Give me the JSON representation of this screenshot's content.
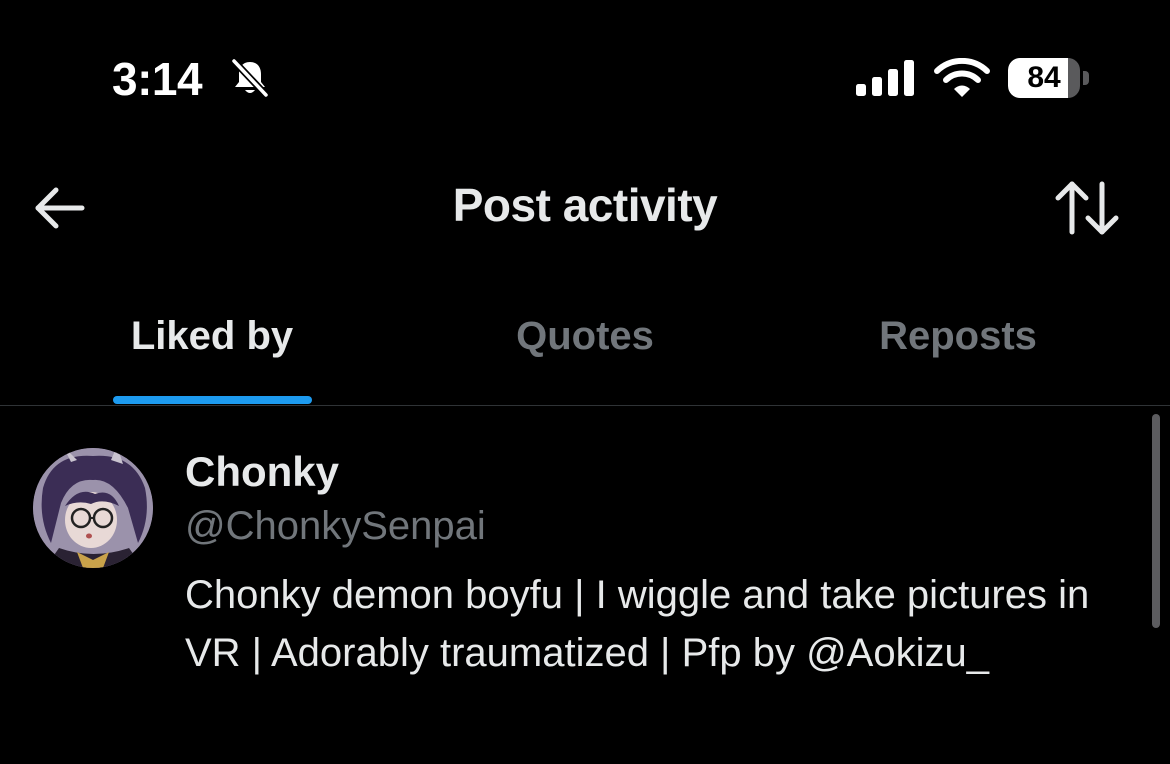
{
  "status_bar": {
    "time": "3:14",
    "silent_icon": "bell-slash-icon",
    "signal_icon": "cellular-signal-icon",
    "wifi_icon": "wifi-icon",
    "battery_percent": "84",
    "battery_level": 0.84
  },
  "header": {
    "back_icon": "arrow-left-icon",
    "title": "Post activity",
    "sort_icon": "sort-arrows-icon"
  },
  "tabs": [
    {
      "label": "Liked by",
      "active": true
    },
    {
      "label": "Quotes",
      "active": false
    },
    {
      "label": "Reposts",
      "active": false
    }
  ],
  "colors": {
    "accent": "#1d9bf0",
    "background": "#000000",
    "primary_text": "#e7e9ea",
    "secondary_text": "#71767b"
  },
  "users": [
    {
      "display_name": "Chonky",
      "handle": "@ChonkySenpai",
      "bio": "Chonky demon boyfu | I wiggle and take pictures in VR | Adorably traumatized | Pfp by @Aokizu_"
    }
  ]
}
